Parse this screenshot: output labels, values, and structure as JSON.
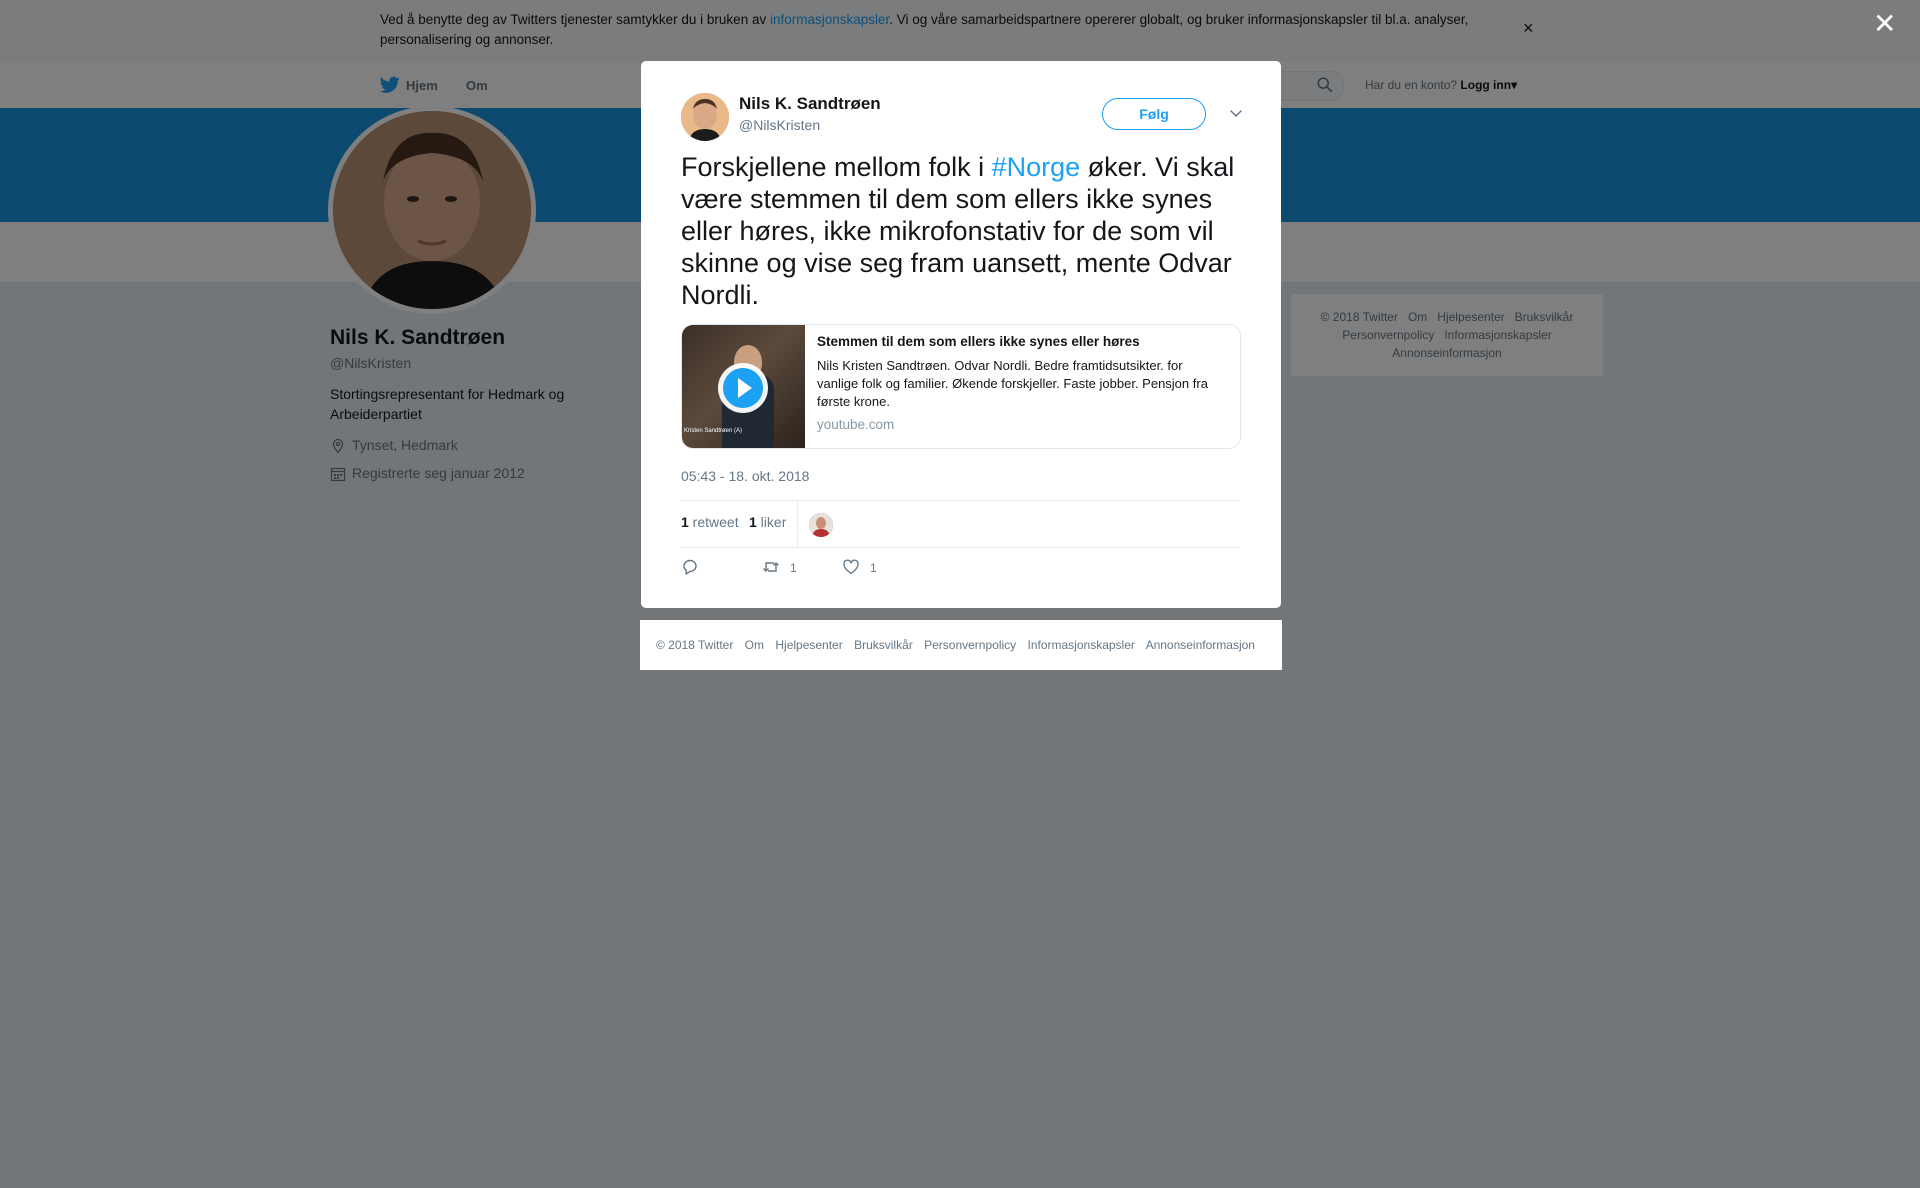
{
  "cookie_banner": {
    "text_before": "Ved å benytte deg av Twitters tjenester samtykker du i bruken av ",
    "link": "informasjonskapsler",
    "text_after": ". Vi og våre samarbeidspartnere opererer globalt, og bruker informasjonskapsler til bl.a. analyser, personalisering og annonser.",
    "close": "×"
  },
  "nav": {
    "home": "Hjem",
    "about": "Om",
    "has_account": "Har du en konto?",
    "login": "Logg inn",
    "login_caret": "▾"
  },
  "profile": {
    "name": "Nils K. Sandtrøen",
    "handle": "@NilsKristen",
    "bio": "Stortingsrepresentant for Hedmark og Arbeiderpartiet",
    "location": "Tynset, Hedmark",
    "joined": "Registrerte seg januar 2012"
  },
  "side_footer": {
    "links": [
      "© 2018 Twitter",
      "Om",
      "Hjelpesenter",
      "Bruksvilkår",
      "Personvernpolicy",
      "Informasjonskapsler",
      "Annonseinformasjon"
    ]
  },
  "overlay": {
    "close": "✕"
  },
  "tweet": {
    "author_name": "Nils K. Sandtrøen",
    "author_handle": "@NilsKristen",
    "follow_label": "Følg",
    "text_before": "Forskjellene mellom folk i ",
    "hashtag": "#Norge",
    "text_after": " øker. Vi skal være stemmen til dem som ellers ikke synes eller høres, ikke mikrofonstativ for de som vil skinne og vise seg fram uansett, mente Odvar Nordli.",
    "card": {
      "title": "Stemmen til dem som ellers ikke synes eller høres",
      "description": "Nils Kristen Sandtrøen. Odvar Nordli. Bedre framtidsutsikter. for vanlige folk og familier. Økende forskjeller. Faste jobber. Pensjon fra første krone.",
      "domain": "youtube.com",
      "thumb_caption": "Kristen Sandtrøen (A)"
    },
    "timestamp": "05:43 - 18. okt. 2018",
    "retweets_count": "1",
    "retweets_label": " retweet",
    "likes_count": "1",
    "likes_label": " liker",
    "actions": {
      "retweet_count": "1",
      "like_count": "1"
    }
  },
  "modal_footer": {
    "links": [
      "© 2018 Twitter",
      "Om",
      "Hjelpesenter",
      "Bruksvilkår",
      "Personvernpolicy",
      "Informasjonskapsler",
      "Annonseinformasjon"
    ]
  },
  "colors": {
    "accent": "#1da1f2",
    "banner": "#1b95e0",
    "text": "#14171a",
    "muted": "#657786"
  }
}
